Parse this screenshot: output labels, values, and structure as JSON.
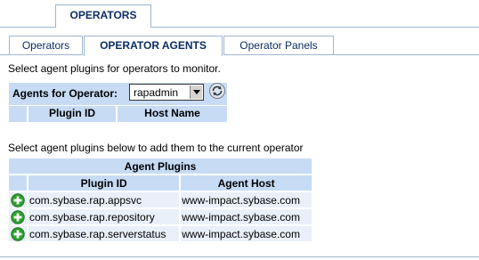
{
  "top_tab": {
    "label": "OPERATORS"
  },
  "sub_tabs": [
    {
      "label": "Operators",
      "selected": false
    },
    {
      "label": "OPERATOR AGENTS",
      "selected": true
    },
    {
      "label": "Operator Panels",
      "selected": false
    }
  ],
  "instructions": {
    "select_monitor": "Select agent plugins for operators to monitor.",
    "select_add": "Select agent plugins below to add them to the current operator"
  },
  "agents_for_operator": {
    "label": "Agents for Operator:",
    "selected_operator": "rapadmin",
    "refresh_icon": "refresh-icon",
    "columns": [
      "Plugin ID",
      "Host Name"
    ],
    "rows": []
  },
  "agent_plugins": {
    "title": "Agent Plugins",
    "columns": [
      "Plugin ID",
      "Agent Host"
    ],
    "add_icon": "add-icon",
    "rows": [
      {
        "plugin_id": "com.sybase.rap.appsvc",
        "agent_host": "www-impact.sybase.com"
      },
      {
        "plugin_id": "com.sybase.rap.repository",
        "agent_host": "www-impact.sybase.com"
      },
      {
        "plugin_id": "com.sybase.rap.serverstatus",
        "agent_host": "www-impact.sybase.com"
      }
    ]
  },
  "colors": {
    "tab_text": "#0c2d63",
    "header_bg": "#c7dbf5",
    "row_bg": "#e9f0fa",
    "border": "#9fb6cf",
    "add_icon_green": "#2e9e2e"
  }
}
